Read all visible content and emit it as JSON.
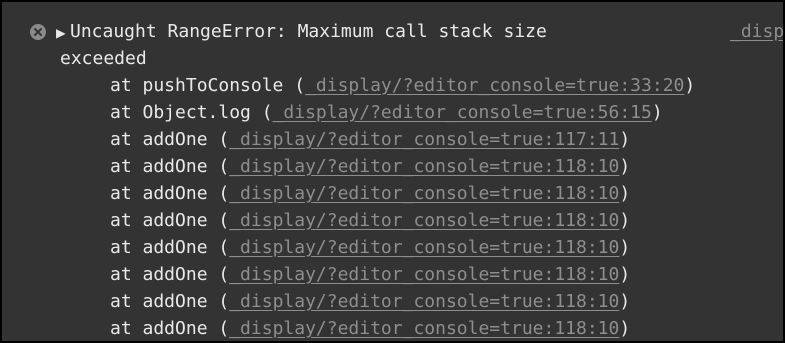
{
  "error": {
    "icon": "error-circle-x-icon",
    "toggle_icon": "expand-triangle-icon",
    "message_line1": "Uncaught RangeError: Maximum call stack size",
    "message_line2": "exceeded",
    "source_link_text": "_disp"
  },
  "stack": [
    {
      "prefix": "at pushToConsole (",
      "link": "_display/?editor_console=true:33:20",
      "suffix": ")"
    },
    {
      "prefix": "at Object.log (",
      "link": "_display/?editor_console=true:56:15",
      "suffix": ")"
    },
    {
      "prefix": "at addOne (",
      "link": "_display/?editor_console=true:117:11",
      "suffix": ")"
    },
    {
      "prefix": "at addOne (",
      "link": "_display/?editor_console=true:118:10",
      "suffix": ")"
    },
    {
      "prefix": "at addOne (",
      "link": "_display/?editor_console=true:118:10",
      "suffix": ")"
    },
    {
      "prefix": "at addOne (",
      "link": "_display/?editor_console=true:118:10",
      "suffix": ")"
    },
    {
      "prefix": "at addOne (",
      "link": "_display/?editor_console=true:118:10",
      "suffix": ")"
    },
    {
      "prefix": "at addOne (",
      "link": "_display/?editor_console=true:118:10",
      "suffix": ")"
    },
    {
      "prefix": "at addOne (",
      "link": "_display/?editor_console=true:118:10",
      "suffix": ")"
    },
    {
      "prefix": "at addOne (",
      "link": "_display/?editor_console=true:118:10",
      "suffix": ")"
    }
  ],
  "colors": {
    "background": "#333333",
    "text": "#e9e9e9",
    "link": "#8e8e8e",
    "icon": "#8a8a8a"
  }
}
